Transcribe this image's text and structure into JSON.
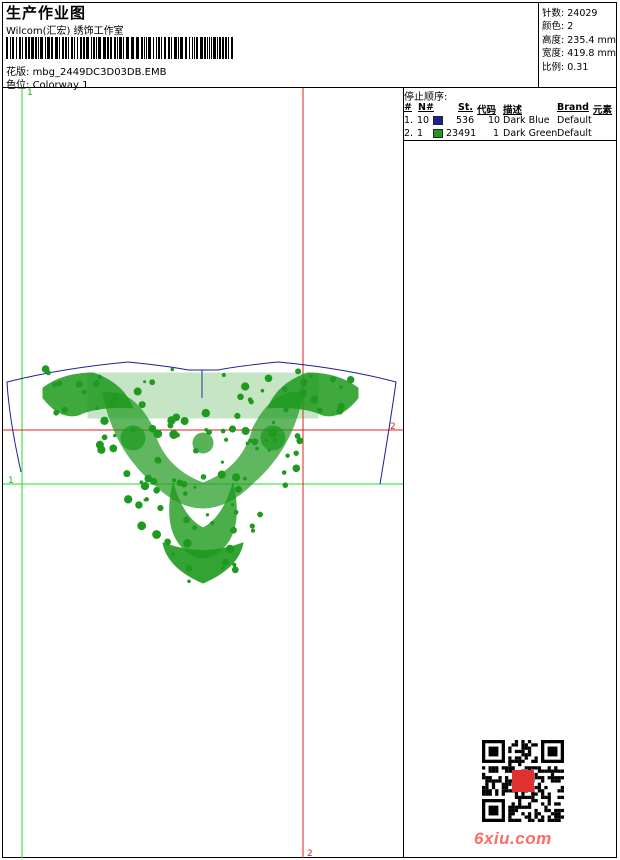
{
  "header": {
    "title": "生产作业图",
    "company": "Wilcom(汇宏) 绣饰工作室",
    "design_label": "花版:",
    "design_name": "mbg_2449DC3D03DB.EMB",
    "colorway_label": "色位:",
    "colorway_name": "Colorway 1"
  },
  "info": [
    {
      "label": "针数:",
      "value": "24029"
    },
    {
      "label": "颜色:",
      "value": "2"
    },
    {
      "label": "高度:",
      "value": "235.4 mm"
    },
    {
      "label": "宽度:",
      "value": "419.8 mm"
    },
    {
      "label": "比例:",
      "value": "0.31"
    }
  ],
  "stop_sequence": {
    "title": "停止顺序:",
    "columns": [
      "#",
      "N#",
      "St.",
      "代码",
      "描述",
      "Brand",
      "元素"
    ],
    "rows": [
      {
        "idx": "1.",
        "needle": "10",
        "color": "#1a1f9c",
        "stitches": "536",
        "code": "10",
        "desc": "Dark Blue",
        "brand": "Default"
      },
      {
        "idx": "2.",
        "needle": "1",
        "color": "#1e9a1e",
        "stitches": "23491",
        "code": "1",
        "desc": "Dark Green",
        "brand": "Default"
      }
    ]
  },
  "guides": {
    "green_v_label": "1",
    "green_h_label": "1",
    "red_h_label": "2",
    "red_v_label": "2"
  },
  "colors": {
    "thread_green": "#1e9a1e",
    "thread_blue": "#1a1f9c",
    "guide_green": "#22dd22",
    "guide_red": "#dd2222"
  },
  "watermark": "6xiu.com",
  "qr_stamp": "印章"
}
